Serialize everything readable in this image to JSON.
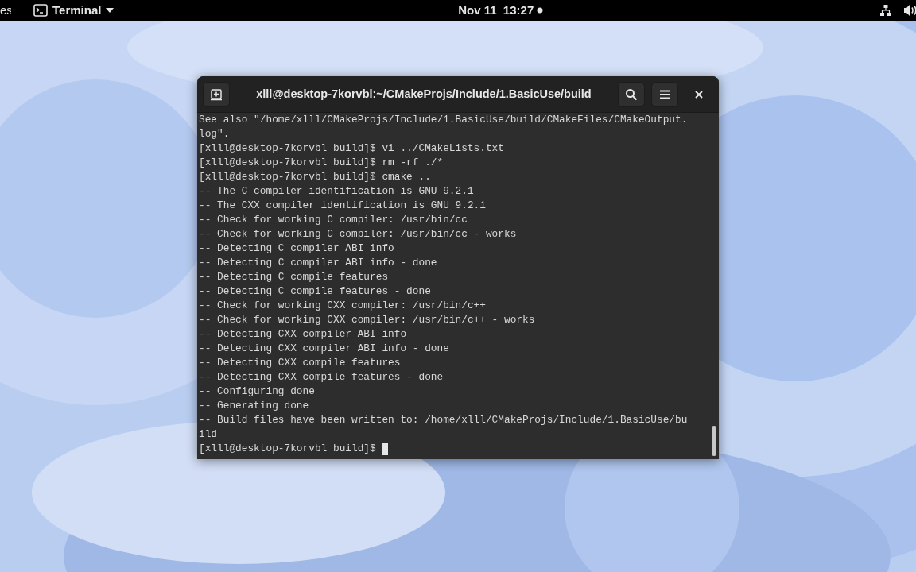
{
  "top_bar": {
    "activities": "es",
    "app_menu": "Terminal",
    "clock": "Nov 11  13:27"
  },
  "window": {
    "title": "xlll@desktop-7korvbl:~/CMakeProjs/Include/1.BasicUse/build",
    "lines": [
      "See also \"/home/xlll/CMakeProjs/Include/1.BasicUse/build/CMakeFiles/CMakeOutput.",
      "log\".",
      "[xlll@desktop-7korvbl build]$ vi ../CMakeLists.txt",
      "[xlll@desktop-7korvbl build]$ rm -rf ./*",
      "[xlll@desktop-7korvbl build]$ cmake ..",
      "-- The C compiler identification is GNU 9.2.1",
      "-- The CXX compiler identification is GNU 9.2.1",
      "-- Check for working C compiler: /usr/bin/cc",
      "-- Check for working C compiler: /usr/bin/cc - works",
      "-- Detecting C compiler ABI info",
      "-- Detecting C compiler ABI info - done",
      "-- Detecting C compile features",
      "-- Detecting C compile features - done",
      "-- Check for working CXX compiler: /usr/bin/c++",
      "-- Check for working CXX compiler: /usr/bin/c++ - works",
      "-- Detecting CXX compiler ABI info",
      "-- Detecting CXX compiler ABI info - done",
      "-- Detecting CXX compile features",
      "-- Detecting CXX compile features - done",
      "-- Configuring done",
      "-- Generating done",
      "-- Build files have been written to: /home/xlll/CMakeProjs/Include/1.BasicUse/bu",
      "ild"
    ],
    "prompt": "[xlll@desktop-7korvbl build]$ "
  }
}
